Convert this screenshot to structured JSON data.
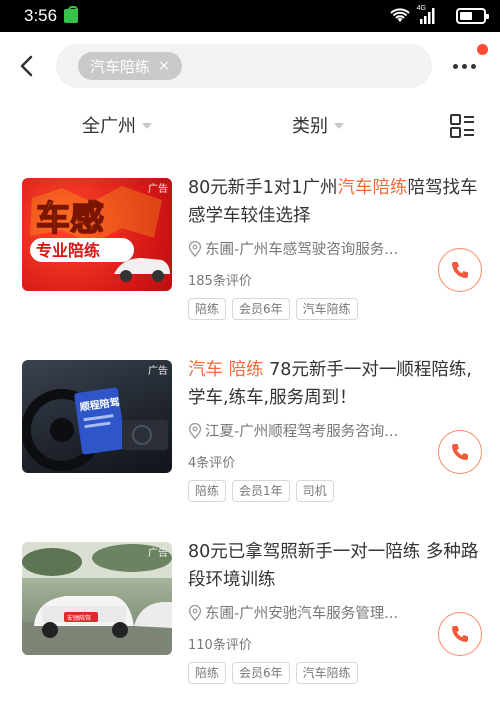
{
  "status_bar": {
    "time": "3:56",
    "network": "4G"
  },
  "search": {
    "chip_label": "汽车陪练",
    "chip_close": "×"
  },
  "filters": {
    "area": "全广州",
    "category": "类别"
  },
  "listings": [
    {
      "ad_label": "广告",
      "thumb_title": "车感",
      "thumb_subtitle": "专业陪练",
      "title_segments": [
        "80元新手1对1广州",
        "汽车陪练",
        "陪驾找车感学车较佳选择"
      ],
      "merchant": "东圃-广州车感驾驶咨询服务...",
      "reviews": "185条评价",
      "tags": [
        "陪练",
        "会员6年",
        "汽车陪练"
      ]
    },
    {
      "ad_label": "广告",
      "thumb_title": "顺程陪驾",
      "title_segments": [
        "汽车 陪练",
        " 78元新手一对一顺程陪练,学车,练车,服务周到！"
      ],
      "merchant": "江夏-广州顺程驾考服务咨询...",
      "reviews": "4条评价",
      "tags": [
        "陪练",
        "会员1年",
        "司机"
      ]
    },
    {
      "ad_label": "广告",
      "thumb_plate": "安驰陪驾",
      "title_segments": [
        "80元已拿驾照新手一对一陪练 多种路段环境训练"
      ],
      "merchant": "东圃-广州安驰汽车服务管理...",
      "reviews": "110条评价",
      "tags": [
        "陪练",
        "会员6年",
        "汽车陪练"
      ]
    }
  ],
  "colors": {
    "highlight": "#f26b3a",
    "call_accent": "#f05a3a",
    "notif_dot": "#ff4b33"
  }
}
